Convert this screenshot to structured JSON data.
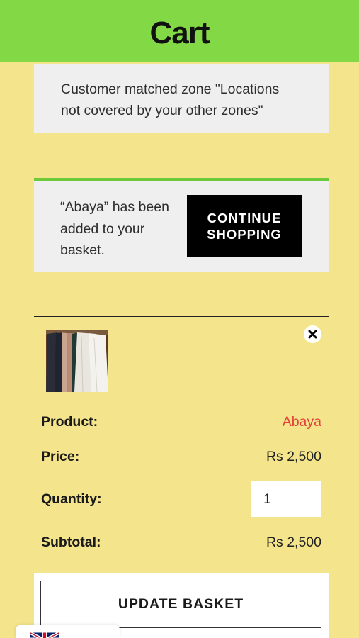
{
  "header": {
    "title": "Cart"
  },
  "notice": {
    "text": "Customer matched zone \"Locations not covered by your other zones\""
  },
  "added_message": {
    "text": "“Abaya” has been added to your basket.",
    "button_label": "CONTINUE\nSHOPPING"
  },
  "cart_item": {
    "remove_icon": "close-icon",
    "thumbnail_alt": "Abaya",
    "product_label": "Product:",
    "product_name": "Abaya",
    "price_label": "Price:",
    "price": "Rs 2,500",
    "quantity_label": "Quantity:",
    "quantity": "1",
    "subtotal_label": "Subtotal:",
    "subtotal": "Rs 2,500"
  },
  "actions": {
    "update_label": "UPDATE BASKET"
  },
  "language_switcher": {
    "icon": "uk-flag-icon"
  },
  "colors": {
    "header_bg": "#83d945",
    "page_bg": "#f4e58c",
    "notice_bg": "#efefef",
    "accent_border": "#6cc93a",
    "link": "#e3403a",
    "button_dark": "#000000"
  }
}
